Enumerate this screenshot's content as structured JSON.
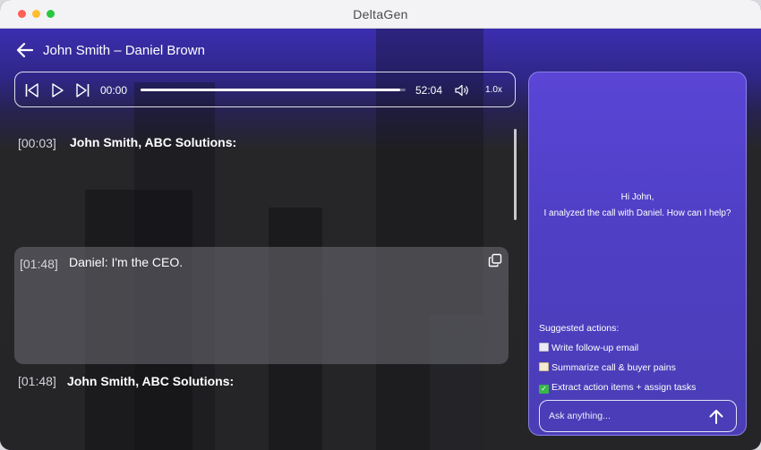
{
  "window": {
    "title": "DeltaGen"
  },
  "header": {
    "title": "John Smith – Daniel Brown"
  },
  "player": {
    "current_time": "00:00",
    "total_time": "52:04",
    "progress": 0.98,
    "speed": "1.0x"
  },
  "transcript": {
    "segments": [
      {
        "timestamp": "[00:03]",
        "text": "John Smith, ABC Solutions:",
        "highlighted": false
      },
      {
        "timestamp": "[01:48]",
        "text": "Daniel: I'm the CEO.",
        "highlighted": true
      },
      {
        "timestamp": "[01:48]",
        "text": "John Smith, ABC Solutions:",
        "highlighted": false
      }
    ]
  },
  "assistant": {
    "greeting_line1": "Hi John,",
    "greeting_line2": "I analyzed the call with Daniel. How can I help?",
    "suggested_title": "Suggested actions:",
    "suggestions": [
      {
        "icon": "envelope-icon",
        "label": "Write follow-up email"
      },
      {
        "icon": "memo-icon",
        "label": "Summarize call & buyer pains"
      },
      {
        "icon": "check-mark-icon",
        "label": "Extract action items + assign tasks"
      }
    ],
    "input_placeholder": "Ask anything..."
  }
}
